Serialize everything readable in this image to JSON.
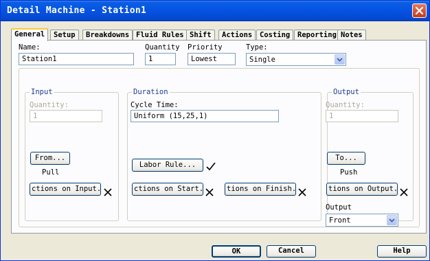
{
  "window": {
    "title": "Detail Machine - Station1"
  },
  "tabs": [
    "General",
    "Setup",
    "Breakdowns",
    "Fluid Rules",
    "Shift",
    "Actions",
    "Costing",
    "Reporting",
    "Notes"
  ],
  "general": {
    "name_label": "Name:",
    "name_value": "Station1",
    "quantity_label": "Quantity",
    "quantity_value": "1",
    "priority_label": "Priority",
    "priority_value": "Lowest",
    "type_label": "Type:",
    "type_value": "Single"
  },
  "input": {
    "group_title": "Input",
    "quantity_label": "Quantity:",
    "quantity_value": "1",
    "from_button": "From...",
    "rule_text": "Pull",
    "actions_button": "ctions on Input..."
  },
  "duration": {
    "group_title": "Duration",
    "cycle_label": "Cycle Time:",
    "cycle_value": "Uniform (15,25,1)",
    "labor_button": "Labor Rule...",
    "start_button": "ctions on Start...",
    "finish_button": "tions on Finish..."
  },
  "output": {
    "group_title": "Output",
    "quantity_label": "Quantity:",
    "quantity_value": "1",
    "to_button": "To...",
    "rule_text": "Push",
    "actions_button": "tions on Output...",
    "output_label": "Output",
    "output_value": "Front"
  },
  "footer": {
    "ok": "OK",
    "cancel": "Cancel",
    "help": "Help"
  }
}
